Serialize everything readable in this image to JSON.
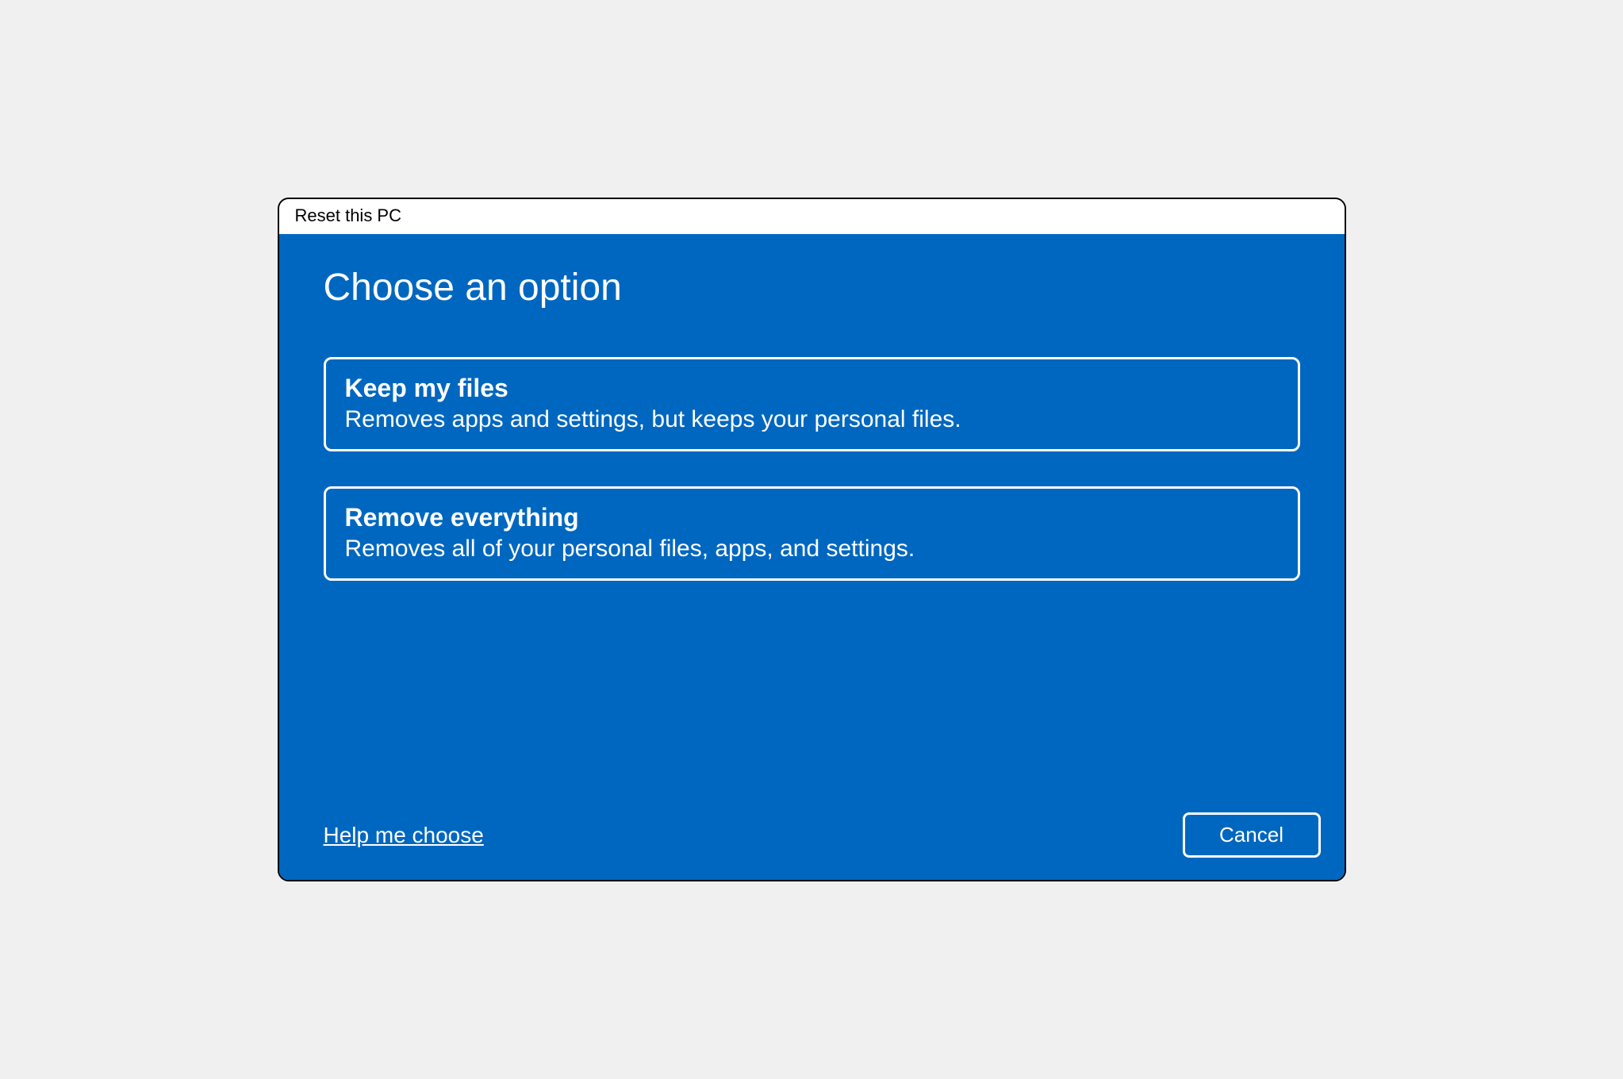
{
  "window": {
    "title": "Reset this PC"
  },
  "main": {
    "heading": "Choose an option",
    "options": [
      {
        "title": "Keep my files",
        "description": "Removes apps and settings, but keeps your personal files."
      },
      {
        "title": "Remove everything",
        "description": "Removes all of your personal files, apps, and settings."
      }
    ]
  },
  "footer": {
    "help_label": "Help me choose",
    "cancel_label": "Cancel"
  },
  "colors": {
    "accent": "#0067c0",
    "text": "#ffffff"
  }
}
